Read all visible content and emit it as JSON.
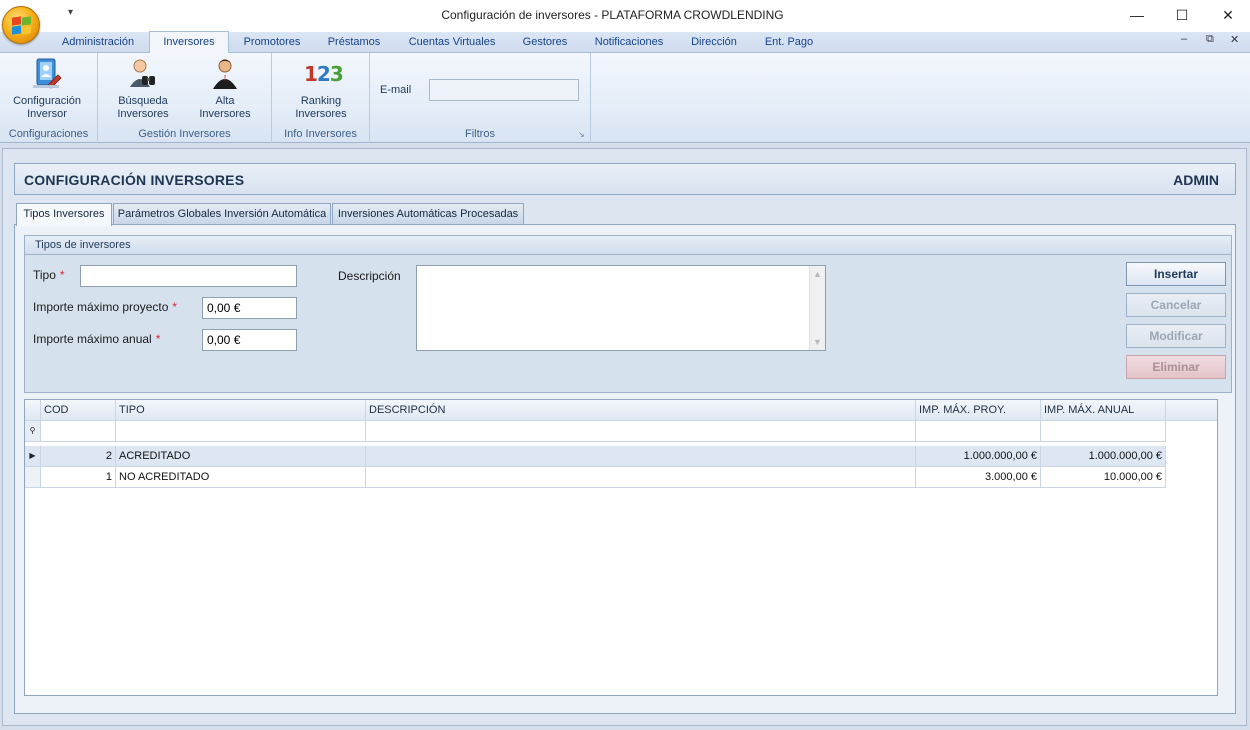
{
  "window": {
    "title": "Configuración de inversores - PLATAFORMA CROWDLENDING",
    "minimize": "—",
    "maximize": "☐",
    "close": "✕",
    "qat_arrow": "▾"
  },
  "ribbon_tabs": [
    {
      "label": "Administración"
    },
    {
      "label": "Inversores",
      "active": true
    },
    {
      "label": "Promotores"
    },
    {
      "label": "Préstamos"
    },
    {
      "label": "Cuentas Virtuales"
    },
    {
      "label": "Gestores"
    },
    {
      "label": "Notificaciones"
    },
    {
      "label": "Dirección"
    },
    {
      "label": "Ent. Pago"
    }
  ],
  "mdi_controls": {
    "minimize": "–",
    "restore": "⧉",
    "close": "✕"
  },
  "ribbon": {
    "groups": [
      {
        "label": "Configuraciones",
        "buttons": [
          {
            "label1": "Configuración",
            "label2": "Inversor",
            "icon": "config-investor-icon"
          }
        ]
      },
      {
        "label": "Gestión Inversores",
        "buttons": [
          {
            "label1": "Búsqueda",
            "label2": "Inversores",
            "icon": "search-investor-icon"
          },
          {
            "label1": "Alta",
            "label2": "Inversores",
            "icon": "add-investor-icon"
          }
        ]
      },
      {
        "label": "Info Inversores",
        "buttons": [
          {
            "label1": "Ranking",
            "label2": "Inversores",
            "icon": "ranking-123-icon"
          }
        ]
      },
      {
        "label": "Filtros"
      }
    ],
    "filters": {
      "email_label": "E-mail",
      "email_value": "",
      "launcher": "↘"
    },
    "ranking_glyph": {
      "d1": "1",
      "d2": "2",
      "d3": "3"
    }
  },
  "header": {
    "title": "CONFIGURACIÓN INVERSORES",
    "user": "ADMIN"
  },
  "page_tabs": [
    {
      "label": "Tipos Inversores",
      "active": true
    },
    {
      "label": "Parámetros Globales Inversión Automática"
    },
    {
      "label": "Inversiones Automáticas Procesadas"
    }
  ],
  "form": {
    "group_title": "Tipos de inversores",
    "required_mark": "*",
    "tipo_label": "Tipo",
    "tipo_value": "",
    "importe_proyecto_label": "Importe máximo proyecto",
    "importe_proyecto_value": "0,00 €",
    "importe_anual_label": "Importe máximo anual",
    "importe_anual_value": "0,00 €",
    "descripcion_label": "Descripción",
    "descripcion_value": ""
  },
  "actions": {
    "insertar": "Insertar",
    "cancelar": "Cancelar",
    "modificar": "Modificar",
    "eliminar": "Eliminar"
  },
  "grid": {
    "columns": [
      "COD",
      "TIPO",
      "DESCRIPCIÓN",
      "IMP. MÁX. PROY.",
      "IMP. MÁX. ANUAL"
    ],
    "filter_icon": "⚲",
    "row_indicator": "▶",
    "rows": [
      {
        "cod": "2",
        "tipo": "ACREDITADO",
        "descripcion": "",
        "imp_proy": "1.000.000,00 €",
        "imp_anual": "1.000.000,00 €"
      },
      {
        "cod": "1",
        "tipo": "NO ACREDITADO",
        "descripcion": "",
        "imp_proy": "3.000,00 €",
        "imp_anual": "10.000,00 €"
      }
    ]
  },
  "colors": {
    "accent": "#15428b",
    "required": "#e0242b",
    "ribbon_bg": "#e4edf8"
  }
}
